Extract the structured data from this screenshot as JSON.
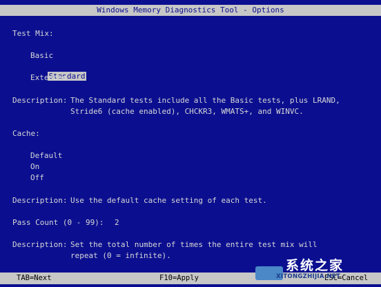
{
  "window": {
    "title": "Windows Memory Diagnostics Tool - Options"
  },
  "test_mix": {
    "label": "Test Mix:",
    "options": [
      "Basic",
      "Standard",
      "Extended"
    ],
    "selected": "Standard",
    "description_label": "Description:",
    "description_lines": [
      "The Standard tests include all the Basic tests, plus LRAND,",
      "Stride6 (cache enabled), CHCKR3, WMATS+, and WINVC."
    ]
  },
  "cache": {
    "label": "Cache:",
    "options": [
      "Default",
      "On",
      "Off"
    ],
    "description_label": "Description:",
    "description_lines": [
      "Use the default cache setting of each test."
    ]
  },
  "pass_count": {
    "label": "Pass Count (0 - 99):",
    "value": "2",
    "description_label": "Description:",
    "description_lines": [
      "Set the total number of times the entire test mix will",
      "repeat (0 = infinite)."
    ]
  },
  "status_bar": {
    "tab_hint": "TAB=Next",
    "apply_hint": "F10=Apply",
    "cancel_hint": "ESC=Cancel"
  },
  "watermark": {
    "chinese_text": "系统之家",
    "english_text": "XITONGZHIJIA.NET"
  },
  "colors": {
    "background": "#0b0f8f",
    "text": "#d7d7d7",
    "bar": "#c7c7c7",
    "highlight_text": "#0b0f8f"
  }
}
